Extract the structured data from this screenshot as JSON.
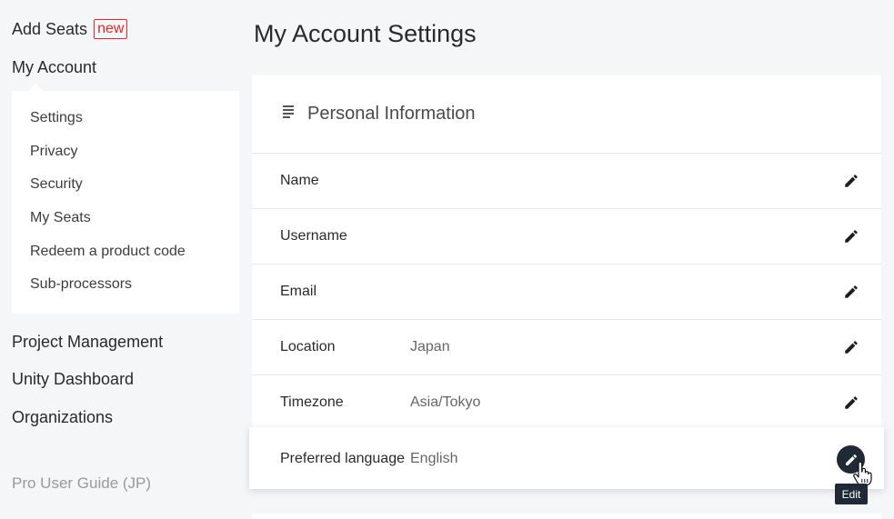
{
  "sidebar": {
    "add_seats": "Add Seats",
    "new_badge": "new",
    "my_account": "My Account",
    "submenu": [
      "Settings",
      "Privacy",
      "Security",
      "My Seats",
      "Redeem a product code",
      "Sub-processors"
    ],
    "lower": [
      "Project Management",
      "Unity Dashboard",
      "Organizations"
    ],
    "guide": "Pro User Guide (JP)"
  },
  "main": {
    "title": "My Account Settings",
    "card_title": "Personal Information",
    "rows": [
      {
        "label": "Name",
        "value": ""
      },
      {
        "label": "Username",
        "value": ""
      },
      {
        "label": "Email",
        "value": ""
      },
      {
        "label": "Location",
        "value": "Japan"
      },
      {
        "label": "Timezone",
        "value": "Asia/Tokyo"
      },
      {
        "label": "Preferred language",
        "value": "English"
      }
    ],
    "tooltip": "Edit"
  },
  "icons": {
    "list": "list-icon",
    "edit": "pencil-icon",
    "cursor": "hand-cursor-icon"
  },
  "colors": {
    "badge": "#e5262a",
    "active_button": "#1f2a36",
    "background": "#f5f6f7"
  }
}
